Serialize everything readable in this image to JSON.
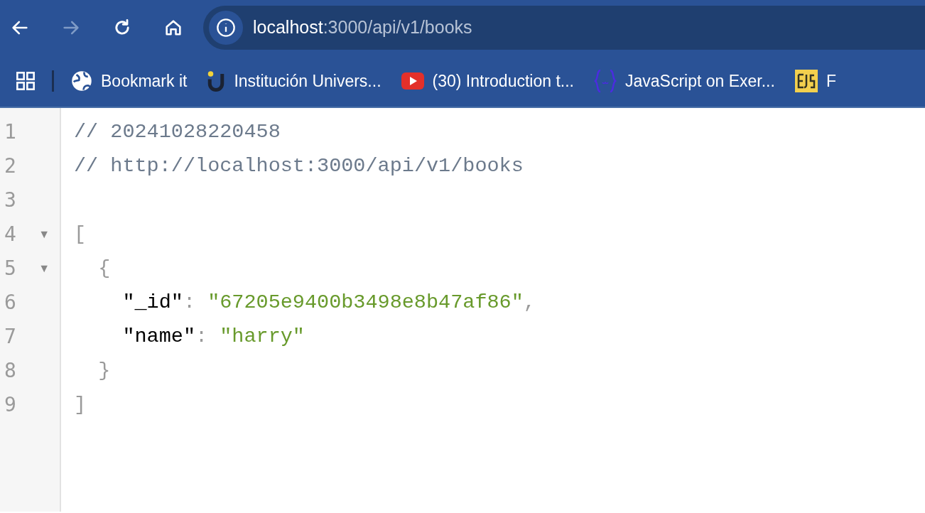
{
  "toolbar": {
    "url": {
      "host": "localhost",
      "path": ":3000/api/v1/books"
    },
    "forward_disabled": true
  },
  "bookmarks": [
    {
      "kind": "globe",
      "label": "Bookmark it"
    },
    {
      "kind": "magnet",
      "label": "Institución Univers..."
    },
    {
      "kind": "video",
      "label": "(30) Introduction t..."
    },
    {
      "kind": "braces",
      "label": "JavaScript on Exer..."
    },
    {
      "kind": "ejs",
      "label": "F"
    }
  ],
  "code_lines": [
    {
      "number": "1",
      "tokens": [
        {
          "kind": "comment",
          "text": "// 20241028220458"
        }
      ]
    },
    {
      "number": "2",
      "tokens": [
        {
          "kind": "comment",
          "text": "// http://localhost:3000/api/v1/books"
        }
      ]
    },
    {
      "number": "3"
    },
    {
      "number": "4",
      "fold": "▼",
      "tokens": [
        {
          "kind": "punct",
          "text": "["
        }
      ],
      "children": [
        {
          "number": "5",
          "fold": "▼",
          "tokens": [
            {
              "kind": "punct",
              "text": "{"
            }
          ],
          "children": [
            {
              "number": "6",
              "tokens": [
                {
                  "kind": "key",
                  "text": "\"_id\""
                },
                {
                  "kind": "punct",
                  "text": ": "
                },
                {
                  "kind": "string",
                  "text": "\"67205e9400b3498e8b47af86\""
                },
                {
                  "kind": "punct",
                  "text": ","
                }
              ]
            },
            {
              "number": "7",
              "tokens": [
                {
                  "kind": "key",
                  "text": "\"name\""
                },
                {
                  "kind": "punct",
                  "text": ": "
                },
                {
                  "kind": "string",
                  "text": "\"harry\""
                }
              ]
            }
          ]
        },
        {
          "number": "8",
          "tokens": [
            {
              "kind": "punct",
              "text": "}"
            }
          ]
        }
      ]
    },
    {
      "number": "9",
      "tokens": [
        {
          "kind": "punct",
          "text": "]"
        }
      ]
    }
  ]
}
